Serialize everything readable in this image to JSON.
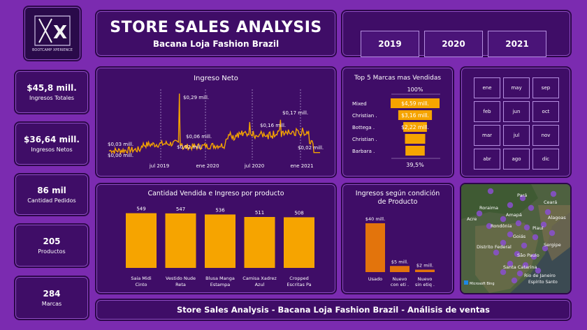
{
  "logo": {
    "mark": "BX",
    "caption": "BOOTCAMP XPERIENCE"
  },
  "header": {
    "title": "STORE SALES ANALYSIS",
    "subtitle": "Bacana Loja Fashion Brazil"
  },
  "years": [
    "2019",
    "2020",
    "2021"
  ],
  "kpis": [
    {
      "value": "$45,8 mill.",
      "label": "Ingresos Totales"
    },
    {
      "value": "$36,64 mill.",
      "label": "Ingresos Netos"
    },
    {
      "value": "86 mil",
      "label": "Cantidad Pedidos"
    },
    {
      "value": "205",
      "label": "Productos"
    },
    {
      "value": "284",
      "label": "Marcas"
    }
  ],
  "months": [
    "ene",
    "may",
    "sep",
    "feb",
    "jun",
    "oct",
    "mar",
    "jul",
    "nov",
    "abr",
    "ago",
    "dic"
  ],
  "line_chart": {
    "title": "Ingreso Neto",
    "x_ticks": [
      "jul 2019",
      "ene 2020",
      "jul 2020",
      "ene 2021"
    ],
    "labels": [
      "$0,03 mill.",
      "$0,00 mill.",
      "$0,29 mill.",
      "$0,06 mill.",
      "$0,02 mill.",
      "$0,16 mill.",
      "$0,17 mill.",
      "$0,02 mill."
    ]
  },
  "funnel": {
    "title": "Top 5 Marcas mas Vendidas",
    "top_pct": "100%",
    "bottom_pct": "39,5%",
    "categories": [
      "Mixed",
      "Christian .",
      "Bottega .",
      "Christian .",
      "Barbara ."
    ],
    "labels": [
      "$4,59 mill.",
      "$3,16 mill.",
      "$2,22 mill.",
      "",
      ""
    ]
  },
  "bar_chart": {
    "title": "Cantidad Vendida e Ingreso por producto",
    "labels": [
      "549",
      "547",
      "536",
      "511",
      "508"
    ],
    "categories": [
      [
        "Saia Midi",
        "Cinto"
      ],
      [
        "Vestido Nude",
        "Reta"
      ],
      [
        "Blusa Manga",
        "Estampa"
      ],
      [
        "Camisa Xadrez",
        "Azul"
      ],
      [
        "Cropped",
        "Escritas Pa"
      ]
    ]
  },
  "condition_chart": {
    "title_line1": "Ingresos según condición",
    "title_line2": "de Producto",
    "labels": [
      "$40 mill.",
      "$5 mill.",
      "$2 mill."
    ],
    "categories": [
      [
        "Usado"
      ],
      [
        "Nuevo",
        "con eti ."
      ],
      [
        "Nuevo",
        "sin etiq ."
      ]
    ]
  },
  "map": {
    "places": [
      "Pará",
      "Ceará",
      "Roraima",
      "Amapá",
      "Alagoas",
      "Acre",
      "Rondônia",
      "Piauí",
      "Goiás",
      "Distrito Federal",
      "Sergipe",
      "São Paulo",
      "Santa Catarina",
      "Rio de Janeiro",
      "Espírito Santo"
    ],
    "attribution": "Microsoft Bing"
  },
  "footer": {
    "text": "Store Sales Analysis - Bacana Loja Fashion Brazil - Análisis de ventas"
  },
  "chart_data": [
    {
      "type": "line",
      "title": "Ingreso Neto",
      "x": [
        "2019-02",
        "2019-04",
        "2019-06",
        "2019-08",
        "2019-10",
        "2019-12",
        "2020-02",
        "2020-04",
        "2020-06",
        "2020-08",
        "2020-10",
        "2020-12",
        "2021-02"
      ],
      "y_annotations_mill": [
        0.03,
        0.0,
        0.29,
        0.06,
        0.02,
        0.16,
        0.17,
        0.02
      ]
    },
    {
      "type": "bar",
      "title": "Top 5 Marcas mas Vendidas",
      "categories": [
        "Mixed",
        "Christian .",
        "Bottega .",
        "Christian .",
        "Barbara ."
      ],
      "values": [
        4.59,
        3.16,
        2.22,
        1.9,
        1.81
      ],
      "unit": "mill."
    },
    {
      "type": "bar",
      "title": "Cantidad Vendida e Ingreso por producto",
      "categories": [
        "Saia Midi Cinto",
        "Vestido Nude Reta",
        "Blusa Manga Estampa",
        "Camisa Xadrez Azul",
        "Cropped Escritas Pa"
      ],
      "values": [
        549,
        547,
        536,
        511,
        508
      ]
    },
    {
      "type": "bar",
      "title": "Ingresos según condición de Producto",
      "categories": [
        "Usado",
        "Nuevo con eti .",
        "Nuevo sin etiq ."
      ],
      "values": [
        40,
        5,
        2
      ],
      "unit": "mill."
    }
  ]
}
